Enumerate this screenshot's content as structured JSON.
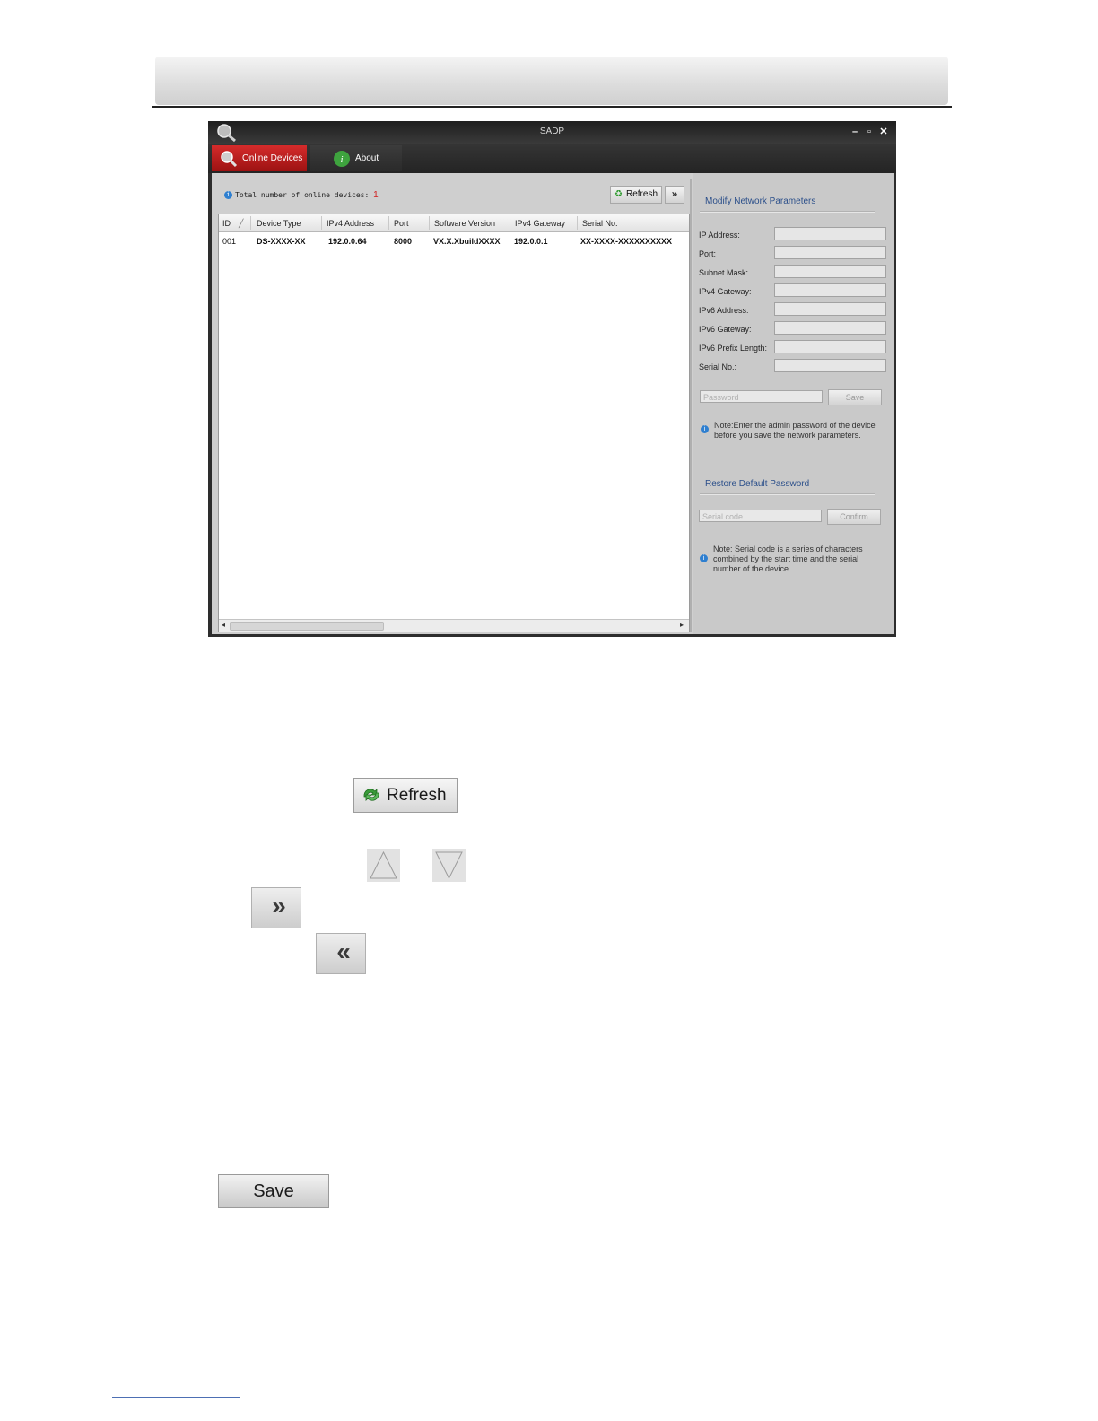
{
  "window": {
    "title": "SADP",
    "controls": [
      "minimize-icon",
      "maximize-icon",
      "close-icon"
    ]
  },
  "tabs": [
    {
      "label": "Online Devices",
      "icon": "search-device-icon",
      "active": true
    },
    {
      "label": "About",
      "icon": "info-icon",
      "active": false
    }
  ],
  "device_list": {
    "total_label": "Total number of online devices:",
    "total_count": "1",
    "refresh_label": "Refresh",
    "expand_label": "»",
    "columns": [
      "ID",
      "Device Type",
      "IPv4 Address",
      "Port",
      "Software Version",
      "IPv4 Gateway",
      "Serial No."
    ],
    "rows": [
      {
        "id": "001",
        "device_type": "DS-XXXX-XX",
        "ipv4": "192.0.0.64",
        "port": "8000",
        "software": "VX.X.XbuildXXXX",
        "gateway": "192.0.0.1",
        "serial": "XX-XXXX-XXXXXXXXXX"
      }
    ]
  },
  "modify_panel": {
    "title": "Modify Network Parameters",
    "fields": [
      {
        "label": "IP Address:",
        "value": ""
      },
      {
        "label": "Port:",
        "value": ""
      },
      {
        "label": "Subnet Mask:",
        "value": ""
      },
      {
        "label": "IPv4 Gateway:",
        "value": ""
      },
      {
        "label": "IPv6 Address:",
        "value": ""
      },
      {
        "label": "IPv6 Gateway:",
        "value": ""
      },
      {
        "label": "IPv6 Prefix Length:",
        "value": ""
      },
      {
        "label": "Serial No.:",
        "value": ""
      }
    ],
    "password_placeholder": "Password",
    "save_label": "Save",
    "note": "Note:Enter the admin password of the device before you save the network parameters."
  },
  "restore_panel": {
    "title": "Restore Default Password",
    "serial_placeholder": "Serial code",
    "confirm_label": "Confirm",
    "note": "Note: Serial code is a series of characters combined by the start time and the serial number of the device."
  },
  "illustrations": {
    "refresh_label": "Refresh",
    "save_label": "Save",
    "expand_symbol": "»",
    "collapse_symbol": "«"
  }
}
